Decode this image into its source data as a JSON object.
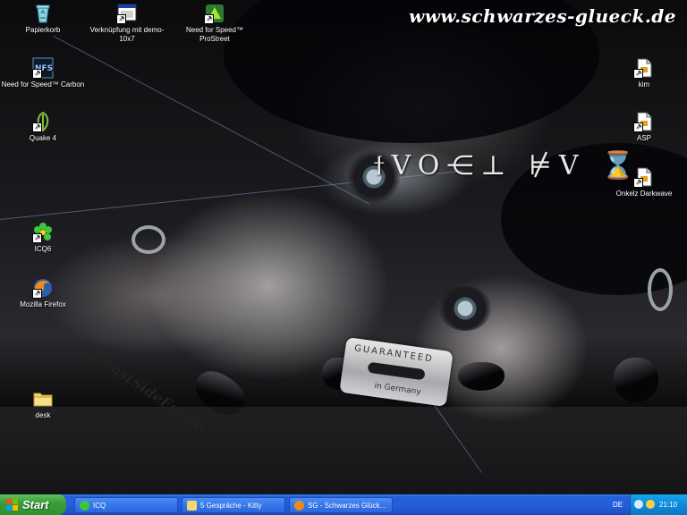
{
  "desktop": {
    "watermark": "www.schwarzes-glueck.de",
    "runes": "ϯVO⋲⊥ ⊭V ⌛",
    "signature": "By EastSideFreaks",
    "blade": {
      "line1": "GUARANTEED",
      "line2": "in Germany"
    },
    "icons": [
      {
        "name": "icon-papierkorb",
        "label": "Papierkorb",
        "icon": "recycle-bin-icon"
      },
      {
        "name": "icon-verknuepfung-demo",
        "label": "Verknüpfung mit demo-10x7",
        "icon": "window-shortcut-icon"
      },
      {
        "name": "icon-nfs-prostreet",
        "label": "Need for Speed™ ProStreet",
        "icon": "game-icon"
      },
      {
        "name": "icon-nfs-carbon",
        "label": "Need for Speed™ Carbon",
        "icon": "nfs-icon"
      },
      {
        "name": "icon-quake4",
        "label": "Quake 4",
        "icon": "quake-icon"
      },
      {
        "name": "icon-icq",
        "label": "ICQ6",
        "icon": "icq-flower-icon"
      },
      {
        "name": "icon-firefox",
        "label": "Mozilla Firefox",
        "icon": "firefox-icon"
      },
      {
        "name": "icon-desk",
        "label": "desk",
        "icon": "folder-icon"
      },
      {
        "name": "icon-kim",
        "label": "kim",
        "icon": "file-shortcut-icon"
      },
      {
        "name": "icon-asp",
        "label": "ASP",
        "icon": "file-shortcut-icon"
      },
      {
        "name": "icon-onkelz",
        "label": "Onkelz Darkwave",
        "icon": "file-shortcut-icon"
      }
    ]
  },
  "taskbar": {
    "start_label": "Start",
    "tasks": [
      {
        "label": "ICQ",
        "icon": "icq-icon"
      },
      {
        "label": "5 Gespräche - Kitty",
        "icon": "chat-icon"
      },
      {
        "label": "SG - Schwarzes Glück...",
        "icon": "firefox-icon"
      }
    ],
    "language": "DE",
    "clock": "21:10"
  },
  "colors": {
    "taskbar_blue": "#245edb",
    "start_green": "#3a9e3a",
    "tray_blue": "#0e8ad9"
  }
}
